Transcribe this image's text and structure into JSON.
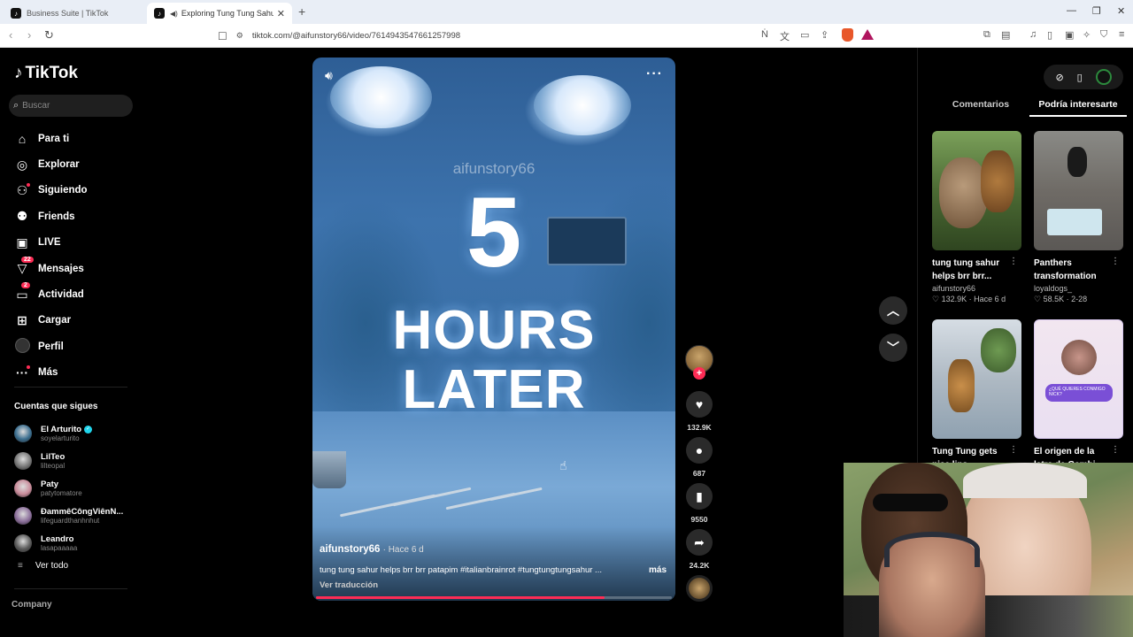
{
  "browser": {
    "tabs": [
      {
        "title": "Business Suite | TikTok",
        "active": false
      },
      {
        "title": "Exploring Tung Tung Sahur: T",
        "active": true
      }
    ],
    "url": "tiktok.com/@aifunstory66/video/7614943547661257998"
  },
  "sidebar": {
    "logo": "TikTok",
    "search_placeholder": "Buscar",
    "menu": [
      {
        "label": "Para ti",
        "icon": "home-icon",
        "glyph": "⌂"
      },
      {
        "label": "Explorar",
        "icon": "compass-icon",
        "glyph": "◎"
      },
      {
        "label": "Siguiendo",
        "icon": "following-icon",
        "glyph": "⚇"
      },
      {
        "label": "Friends",
        "icon": "friends-icon",
        "glyph": "⚉"
      },
      {
        "label": "LIVE",
        "icon": "live-tv-icon",
        "glyph": "▣"
      },
      {
        "label": "Mensajes",
        "icon": "messages-icon",
        "glyph": "▽",
        "badge": "22"
      },
      {
        "label": "Actividad",
        "icon": "activity-icon",
        "glyph": "▭",
        "badge": "2"
      },
      {
        "label": "Cargar",
        "icon": "upload-icon",
        "glyph": "⊞"
      },
      {
        "label": "Perfil",
        "icon": "profile-avatar",
        "glyph": ""
      },
      {
        "label": "Más",
        "icon": "more-icon",
        "glyph": "···"
      }
    ],
    "following_heading": "Cuentas que sigues",
    "following": [
      {
        "name": "El Arturito",
        "username": "soyelarturito",
        "verified": true,
        "color": "#3b6e8f"
      },
      {
        "name": "LilTeo",
        "username": "lilteopal",
        "verified": false,
        "color": "#777777"
      },
      {
        "name": "Paty",
        "username": "patytomatore",
        "verified": false,
        "color": "#c98b9a"
      },
      {
        "name": "ĐammêCôngViênN...",
        "username": "lifeguardthanhnhut",
        "verified": false,
        "color": "#8b6e9a"
      },
      {
        "name": "Leandro",
        "username": "lasapaaaaa",
        "verified": false,
        "color": "#5a5a5a"
      }
    ],
    "see_all": "Ver todo",
    "company": "Company"
  },
  "video": {
    "watermark": "aifunstory66",
    "overlay_lines": [
      "5",
      "HOURS",
      "LATER"
    ],
    "author": "aifunstory66",
    "time_ago": "Hace 6 d",
    "caption": "tung tung sahur helps brr brr patapim #italianbrainrot #tungtungtungsahur ...",
    "more": "más",
    "translate": "Ver traducción",
    "progress": 0.81
  },
  "actions": {
    "likes": "132.9K",
    "comments": "687",
    "saves": "9550",
    "shares": "24.2K"
  },
  "right_panel": {
    "tabs": [
      "Comentarios",
      "Podría interesarte"
    ],
    "active_tab": 1,
    "cards": [
      {
        "title": "tung tung sahur helps brr brr...",
        "user": "aifunstory66",
        "likes": "132.9K",
        "date": "Hace 6 d"
      },
      {
        "title": "Panthers transformation",
        "user": "loyaldogs_",
        "likes": "58.5K",
        "date": "2-28"
      },
      {
        "title": "Tung Tung gets nice lips",
        "user": "",
        "likes": "",
        "date": ""
      },
      {
        "title": "El origen de la letra de Gambi",
        "user": "",
        "likes": "",
        "date": ""
      }
    ],
    "card4_chat": "¿QUÉ QUIERES CONMIGO NICK?"
  },
  "colors": {
    "accent": "#fe2c55",
    "verified": "#20d5ec",
    "background": "#000000"
  }
}
